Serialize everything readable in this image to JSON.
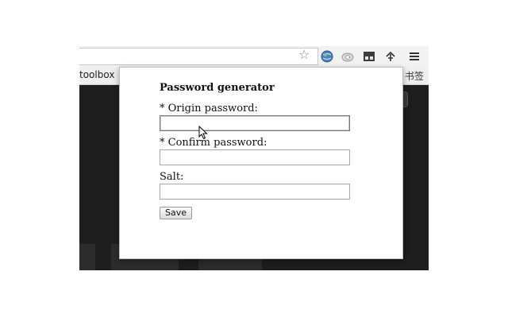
{
  "browser": {
    "bookmarks": {
      "left_item": "toolbox",
      "right_item": "书签"
    },
    "icons": [
      "star-icon",
      "extension-globe-icon",
      "extension-cloud-icon",
      "extension-grid-icon",
      "extension-puzzle-icon",
      "menu-icon"
    ]
  },
  "popup": {
    "title": "Password generator",
    "origin_label": "* Origin password:",
    "origin_value": "",
    "confirm_label": "* Confirm password:",
    "confirm_value": "",
    "salt_label": "Salt:",
    "salt_value": "",
    "save_label": "Save"
  }
}
